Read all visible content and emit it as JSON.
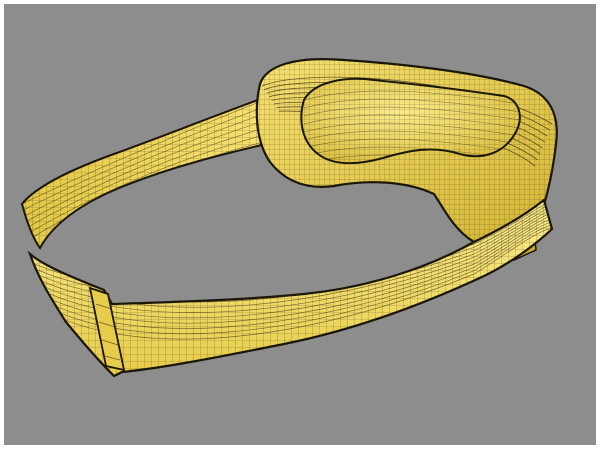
{
  "scene": {
    "subject": "goggles-wireframe",
    "colors": {
      "background": "#8d8d8d",
      "frame": "#ffffff",
      "mesh_fill": "#f3dc62",
      "mesh_fill_shadow": "#d9bd3c",
      "mesh_fill_light": "#fbeb8a",
      "wire": "#2a2410",
      "edge_dark": "#1a1608"
    }
  }
}
